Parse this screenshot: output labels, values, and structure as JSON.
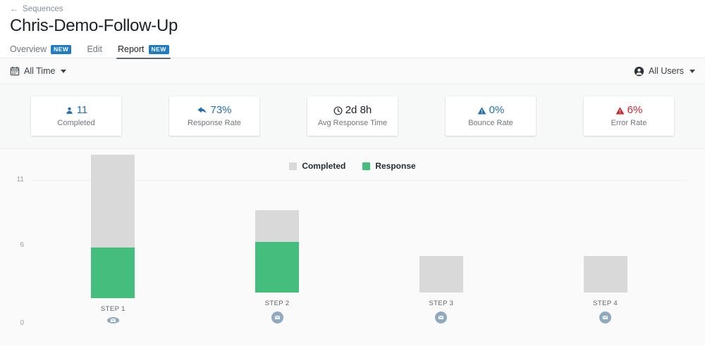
{
  "header": {
    "breadcrumb": {
      "icon": "arrow-left-icon",
      "arrow": "←",
      "label": "Sequences"
    },
    "title": "Chris-Demo-Follow-Up",
    "tabs": [
      {
        "label": "Overview",
        "badge": "NEW",
        "active": false
      },
      {
        "label": "Edit",
        "badge": "",
        "active": false
      },
      {
        "label": "Report",
        "badge": "NEW",
        "active": true
      }
    ]
  },
  "filter_bar": {
    "date_filter": {
      "icon": "calendar-icon",
      "label": "All Time"
    },
    "user_filter": {
      "icon": "person-circle-icon",
      "label": "All Users"
    }
  },
  "stats": [
    {
      "icon": "person-icon",
      "value": "11",
      "label": "Completed",
      "color": "#1f6fb2"
    },
    {
      "icon": "reply-arrow-icon",
      "value": "73%",
      "label": "Response Rate",
      "color": "#1f6fb2"
    },
    {
      "icon": "clock-icon",
      "value": "2d 8h",
      "label": "Avg Response Time",
      "color": "#1b2126"
    },
    {
      "icon": "warning-triangle-icon",
      "value": "0%",
      "label": "Bounce Rate",
      "color": "#1f6fb2"
    },
    {
      "icon": "warning-triangle-icon",
      "value": "6%",
      "label": "Error Rate",
      "color": "#d0242c"
    }
  ],
  "chart_data": {
    "type": "bar",
    "title": "",
    "xlabel": "",
    "ylabel": "",
    "stacked": true,
    "grid": true,
    "legend_position": "top-center",
    "categories": [
      "STEP 1",
      "STEP 2",
      "STEP 3",
      "STEP 4"
    ],
    "ylim": [
      0,
      11
    ],
    "yticks": [
      0,
      6,
      11
    ],
    "ytick_labels": [
      "0",
      "6",
      "11"
    ],
    "series": [
      {
        "name": "Completed",
        "color": "#d9d9d9",
        "values": [
          11,
          6.3,
          2.8,
          2.8
        ]
      },
      {
        "name": "Response",
        "color": "#45bd7c",
        "values": [
          3.9,
          3.9,
          0,
          0
        ]
      }
    ],
    "step_icons": [
      "email-icon",
      "email-icon",
      "email-icon",
      "email-icon"
    ]
  }
}
